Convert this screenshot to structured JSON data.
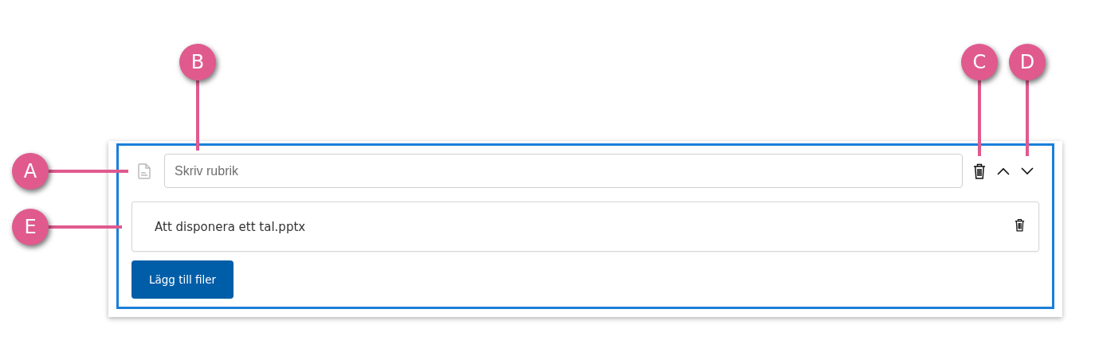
{
  "section_card": {
    "heading_field": {
      "placeholder": "Skriv rubrik"
    },
    "files": [
      {
        "name": "Att disponera ett tal.pptx"
      }
    ],
    "add_button": {
      "label": "Lägg till filer"
    }
  },
  "callouts": [
    {
      "label": "A",
      "kind": "left"
    },
    {
      "label": "B",
      "kind": "up"
    },
    {
      "label": "C",
      "kind": "up"
    },
    {
      "label": "D",
      "kind": "up"
    },
    {
      "label": "E",
      "kind": "left"
    }
  ]
}
